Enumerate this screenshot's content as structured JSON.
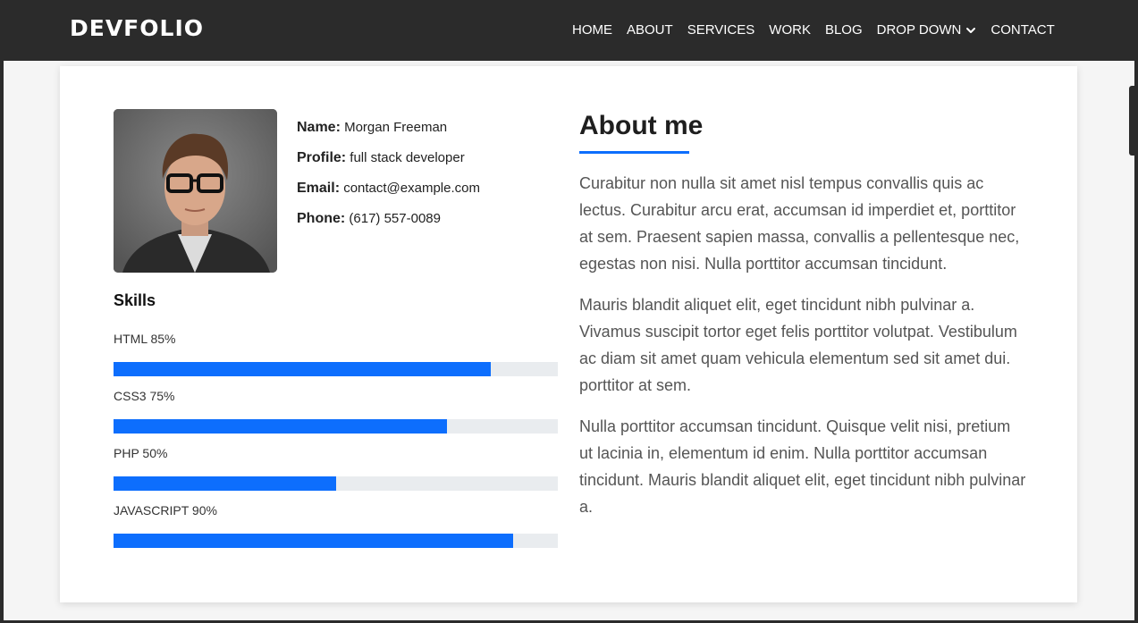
{
  "brand": "DEVFOLIO",
  "nav": {
    "home": "HOME",
    "about": "ABOUT",
    "services": "SERVICES",
    "work": "WORK",
    "blog": "BLOG",
    "dropdown": "DROP DOWN",
    "contact": "CONTACT"
  },
  "profile": {
    "name_label": "Name:",
    "name": "Morgan Freeman",
    "profile_label": "Profile:",
    "profile": "full stack developer",
    "email_label": "Email:",
    "email": "contact@example.com",
    "phone_label": "Phone:",
    "phone": "(617) 557-0089"
  },
  "skills": {
    "title": "Skills",
    "items": [
      {
        "label": "HTML 85%",
        "percent": 85
      },
      {
        "label": "CSS3 75%",
        "percent": 75
      },
      {
        "label": "PHP 50%",
        "percent": 50
      },
      {
        "label": "JAVASCRIPT 90%",
        "percent": 90
      }
    ]
  },
  "about": {
    "title": "About me",
    "paragraphs": [
      "Curabitur non nulla sit amet nisl tempus convallis quis ac lectus. Curabitur arcu erat, accumsan id imperdiet et, porttitor at sem. Praesent sapien massa, convallis a pellentesque nec, egestas non nisi. Nulla porttitor accumsan tincidunt.",
      "Mauris blandit aliquet elit, eget tincidunt nibh pulvinar a. Vivamus suscipit tortor eget felis porttitor volutpat. Vestibulum ac diam sit amet quam vehicula elementum sed sit amet dui. porttitor at sem.",
      "Nulla porttitor accumsan tincidunt. Quisque velit nisi, pretium ut lacinia in, elementum id enim. Nulla porttitor accumsan tincidunt. Mauris blandit aliquet elit, eget tincidunt nibh pulvinar a."
    ]
  },
  "colors": {
    "accent": "#0d6efd",
    "navbar": "#2b2b2b",
    "track": "#e9ecef"
  },
  "icons": {
    "dropdown": "chevron-down-icon",
    "photo": "profile-photo"
  }
}
